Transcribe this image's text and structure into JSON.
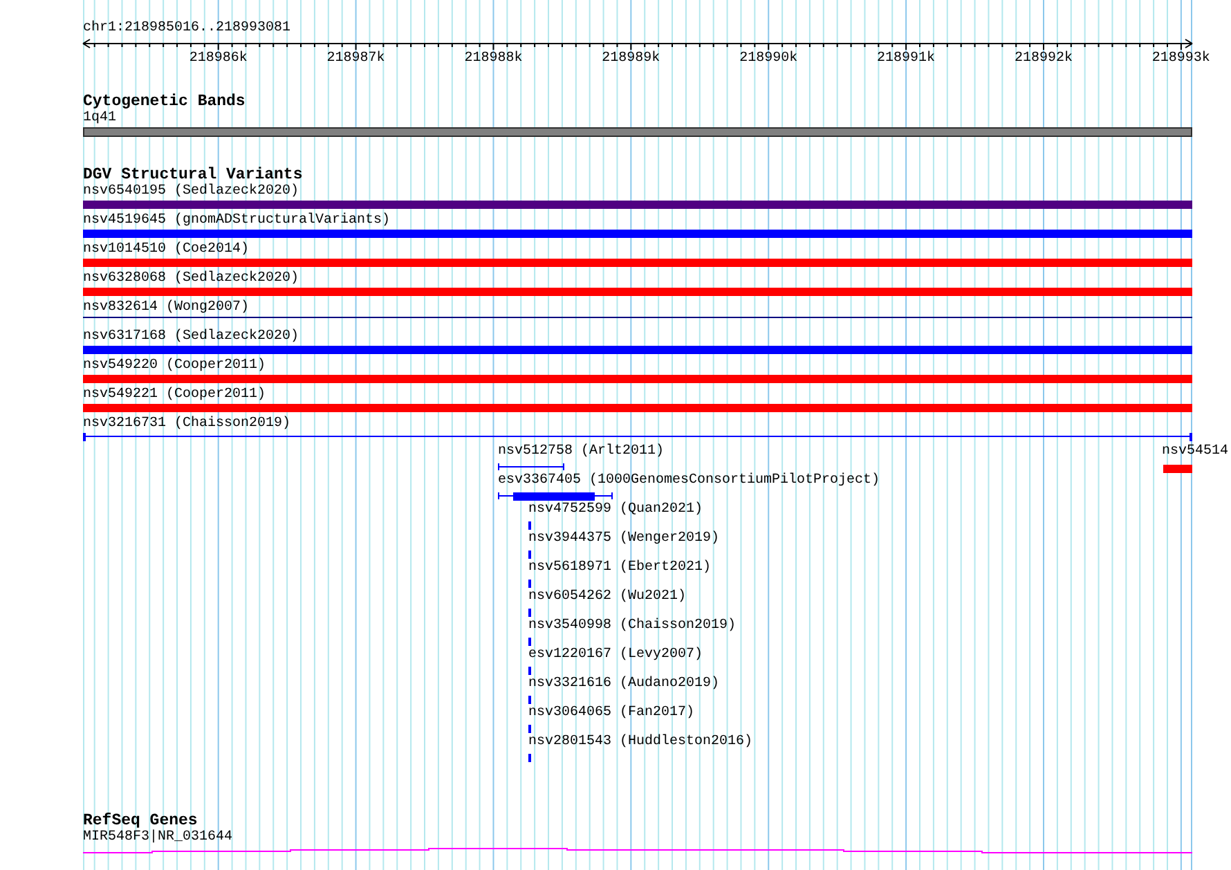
{
  "ruler": {
    "location": "chr1:218985016..218993081",
    "ticks": [
      "218986k",
      "218987k",
      "218988k",
      "218989k",
      "218990k",
      "218991k",
      "218992k",
      "218993k"
    ]
  },
  "tracks": [
    {
      "kind": "cytoband",
      "title": "Cytogenetic Bands",
      "features": [
        {
          "label": "1q41"
        }
      ]
    },
    {
      "kind": "variants",
      "title": "DGV Structural Variants",
      "features": [
        {
          "label": "nsv6540195 (Sedlazeck2020)",
          "kind": "bar",
          "color": "#500082"
        },
        {
          "label": "nsv4519645 (gnomADStructuralVariants)",
          "kind": "bar",
          "color": "#0000ff"
        },
        {
          "label": "nsv1014510 (Coe2014)",
          "kind": "bar",
          "color": "#ff0000"
        },
        {
          "label": "nsv6328068 (Sedlazeck2020)",
          "kind": "bar",
          "color": "#ff0000"
        },
        {
          "label": "nsv832614 (Wong2007)",
          "kind": "line",
          "color": "#000080"
        },
        {
          "label": "nsv6317168 (Sedlazeck2020)",
          "kind": "bar",
          "color": "#0000ff"
        },
        {
          "label": "nsv549220 (Cooper2011)",
          "kind": "bar",
          "color": "#ff0000"
        },
        {
          "label": "nsv549221 (Cooper2011)",
          "kind": "bar",
          "color": "#ff0000"
        },
        {
          "label": "nsv3216731 (Chaisson2019)",
          "kind": "capped",
          "color": "#0000ff"
        },
        {
          "label": "nsv512758 (Arlt2011)",
          "kind": "bracket",
          "color": "#0000ff"
        },
        {
          "label": "nsv54514",
          "kind": "bar",
          "color": "#ff0000"
        },
        {
          "label": "esv3367405 (1000GenomesConsortiumPilotProject)",
          "kind": "bracket-thick",
          "color": "#0000ff"
        },
        {
          "label": "nsv4752599 (Quan2021)",
          "kind": "tick",
          "color": "#0000ff"
        },
        {
          "label": "nsv3944375 (Wenger2019)",
          "kind": "tick",
          "color": "#0000ff"
        },
        {
          "label": "nsv5618971 (Ebert2021)",
          "kind": "tick",
          "color": "#0000ff"
        },
        {
          "label": "nsv6054262 (Wu2021)",
          "kind": "tick",
          "color": "#0000ff"
        },
        {
          "label": "nsv3540998 (Chaisson2019)",
          "kind": "tick",
          "color": "#0000ff"
        },
        {
          "label": "esv1220167 (Levy2007)",
          "kind": "tick",
          "color": "#0000ff"
        },
        {
          "label": "nsv3321616 (Audano2019)",
          "kind": "tick",
          "color": "#0000ff"
        },
        {
          "label": "nsv3064065 (Fan2017)",
          "kind": "tick",
          "color": "#0000ff"
        },
        {
          "label": "nsv2801543 (Huddleston2016)",
          "kind": "tick",
          "color": "#0000ff"
        }
      ]
    },
    {
      "kind": "genes",
      "title": "RefSeq Genes",
      "features": [
        {
          "label": "MIR548F3|NR_031644"
        }
      ]
    }
  ]
}
